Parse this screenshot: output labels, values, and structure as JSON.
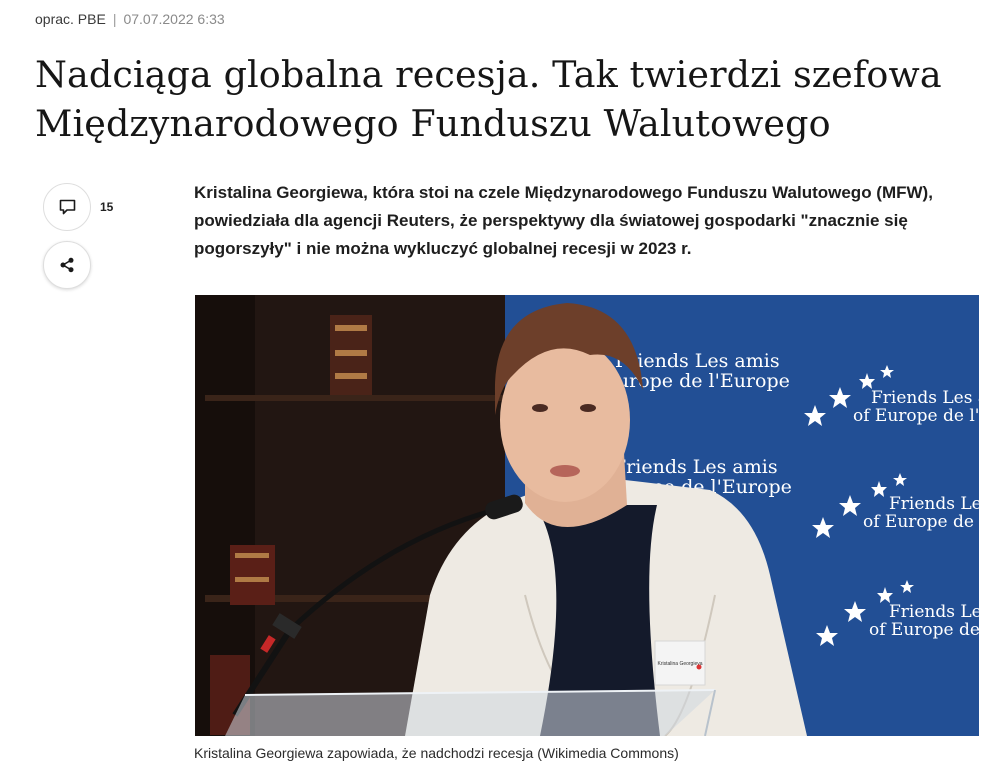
{
  "article": {
    "author": "oprac. PBE",
    "separator": "|",
    "date": "07.07.2022 6:33",
    "title_line1": "Nadciąga globalna recesja. Tak twierdzi szefowa",
    "title_line2": "Międzynarodowego Funduszu Walutowego",
    "lead": "Kristalina Georgiewa, która stoi na czele Międzynarodowego Funduszu Walutowego (MFW), powiedziała dla agencji Reuters, że perspektywy dla światowej gospodarki \"znacznie się pogorszyły\" i nie można wykluczyć globalnej recesji w 2023 r.",
    "image_caption": "Kristalina Georgiewa zapowiada, że nadchodzi recesja (Wikimedia Commons)"
  },
  "actions": {
    "comments_icon": "comment-icon",
    "comment_count": "15",
    "share_icon": "share-icon"
  },
  "photo": {
    "backdrop_text": [
      "Friends Les amis",
      "Europe de l'Europe",
      "Friends Les amis",
      "Europe de l'Europe",
      "Friends Les a",
      "of Europe de l'E",
      "Friends Les",
      "of Europe de l",
      "Friends Le",
      "of Europe de"
    ],
    "nameplate": "Kristalina Georgieva",
    "colors": {
      "backdrop": "#1f4b91",
      "cardigan": "#eeeae3",
      "top": "#141a2b"
    }
  }
}
